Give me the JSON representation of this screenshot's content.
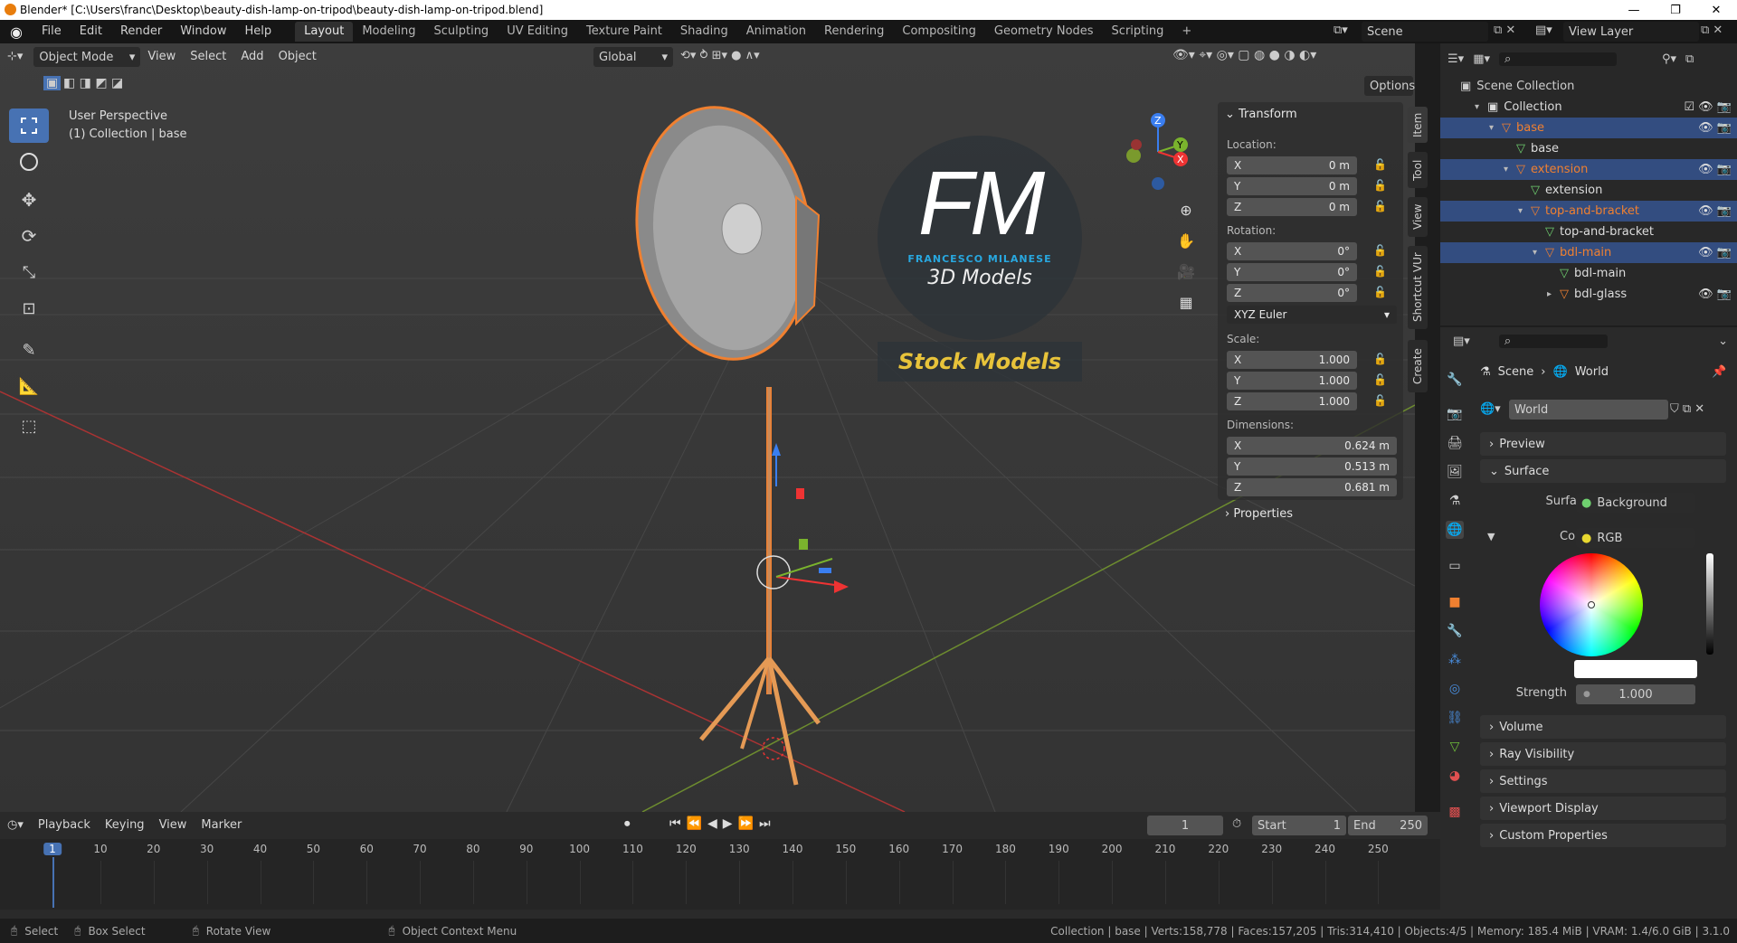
{
  "window": {
    "title": "Blender* [C:\\Users\\franc\\Desktop\\beauty-dish-lamp-on-tripod\\beauty-dish-lamp-on-tripod.blend]",
    "minimize": "—",
    "maximize": "❐",
    "close": "✕"
  },
  "menu": [
    "File",
    "Edit",
    "Render",
    "Window",
    "Help"
  ],
  "workspaces": [
    "Layout",
    "Modeling",
    "Sculpting",
    "UV Editing",
    "Texture Paint",
    "Shading",
    "Animation",
    "Rendering",
    "Compositing",
    "Geometry Nodes",
    "Scripting",
    "+"
  ],
  "scene": {
    "name": "Scene",
    "view_layer": "View Layer"
  },
  "viewport": {
    "mode": "Object Mode",
    "menus": [
      "View",
      "Select",
      "Add",
      "Object"
    ],
    "orientation": "Global",
    "options": "Options",
    "perspective": "User Perspective",
    "collection_info": "(1) Collection | base",
    "axes": {
      "x": "X",
      "y": "Y",
      "z": "Z"
    }
  },
  "logo": {
    "initials": "FM",
    "name": "FRANCESCO MILANESE",
    "subtitle": "3D Models",
    "banner": "Stock Models"
  },
  "transform": {
    "header": "Transform",
    "location_label": "Location:",
    "location": [
      [
        "X",
        "0 m"
      ],
      [
        "Y",
        "0 m"
      ],
      [
        "Z",
        "0 m"
      ]
    ],
    "rotation_label": "Rotation:",
    "rotation": [
      [
        "X",
        "0°"
      ],
      [
        "Y",
        "0°"
      ],
      [
        "Z",
        "0°"
      ]
    ],
    "rotation_mode": "XYZ Euler",
    "scale_label": "Scale:",
    "scale": [
      [
        "X",
        "1.000"
      ],
      [
        "Y",
        "1.000"
      ],
      [
        "Z",
        "1.000"
      ]
    ],
    "dimensions_label": "Dimensions:",
    "dimensions": [
      [
        "X",
        "0.624 m"
      ],
      [
        "Y",
        "0.513 m"
      ],
      [
        "Z",
        "0.681 m"
      ]
    ],
    "properties": "Properties"
  },
  "side_tabs": [
    "Item",
    "Tool",
    "View",
    "Shortcut VUr",
    "Create"
  ],
  "outliner": {
    "root": "Scene Collection",
    "rows": [
      {
        "label": "Collection",
        "depth": 1,
        "kind": "collection",
        "selected": false
      },
      {
        "label": "base",
        "depth": 2,
        "kind": "object",
        "selected": true
      },
      {
        "label": "base",
        "depth": 3,
        "kind": "mesh",
        "selected": false
      },
      {
        "label": "extension",
        "depth": 3,
        "kind": "object",
        "selected": true
      },
      {
        "label": "extension",
        "depth": 4,
        "kind": "mesh",
        "selected": false
      },
      {
        "label": "top-and-bracket",
        "depth": 4,
        "kind": "object",
        "selected": true
      },
      {
        "label": "top-and-bracket",
        "depth": 5,
        "kind": "mesh",
        "selected": false
      },
      {
        "label": "bdl-main",
        "depth": 5,
        "kind": "object",
        "selected": true
      },
      {
        "label": "bdl-main",
        "depth": 6,
        "kind": "mesh",
        "selected": false
      },
      {
        "label": "bdl-glass",
        "depth": 6,
        "kind": "object",
        "selected": false
      }
    ]
  },
  "properties": {
    "breadcrumb": [
      "Scene",
      "World"
    ],
    "world_name": "World",
    "preview": "Preview",
    "surface_header": "Surface",
    "surface_label": "Surface",
    "surface_value": "Background",
    "color_label": "Color",
    "color_value": "RGB",
    "strength_label": "Strength",
    "strength_value": "1.000",
    "sections": [
      "Volume",
      "Ray Visibility",
      "Settings",
      "Viewport Display",
      "Custom Properties"
    ]
  },
  "timeline": {
    "menus": [
      "Playback",
      "Keying",
      "View",
      "Marker"
    ],
    "current_frame": "1",
    "start_label": "Start",
    "start": "1",
    "end_label": "End",
    "end": "250",
    "ticks": [
      "1",
      "10",
      "20",
      "30",
      "40",
      "50",
      "60",
      "70",
      "80",
      "90",
      "100",
      "110",
      "120",
      "130",
      "140",
      "150",
      "160",
      "170",
      "180",
      "190",
      "200",
      "210",
      "220",
      "230",
      "240",
      "250"
    ]
  },
  "status": {
    "select": "Select",
    "box_select": "Box Select",
    "rotate_view": "Rotate View",
    "context_menu": "Object Context Menu",
    "stats": "Collection | base | Verts:158,778 | Faces:157,205 | Tris:314,410 | Objects:4/5 | Memory: 185.4 MiB | VRAM: 1.4/6.0 GiB | 3.1.0"
  },
  "colors": {
    "accent": "#4772b3",
    "selection_orange": "#f08030",
    "logo_blue": "#28a8e0",
    "banner_yellow": "#e8c33a"
  }
}
